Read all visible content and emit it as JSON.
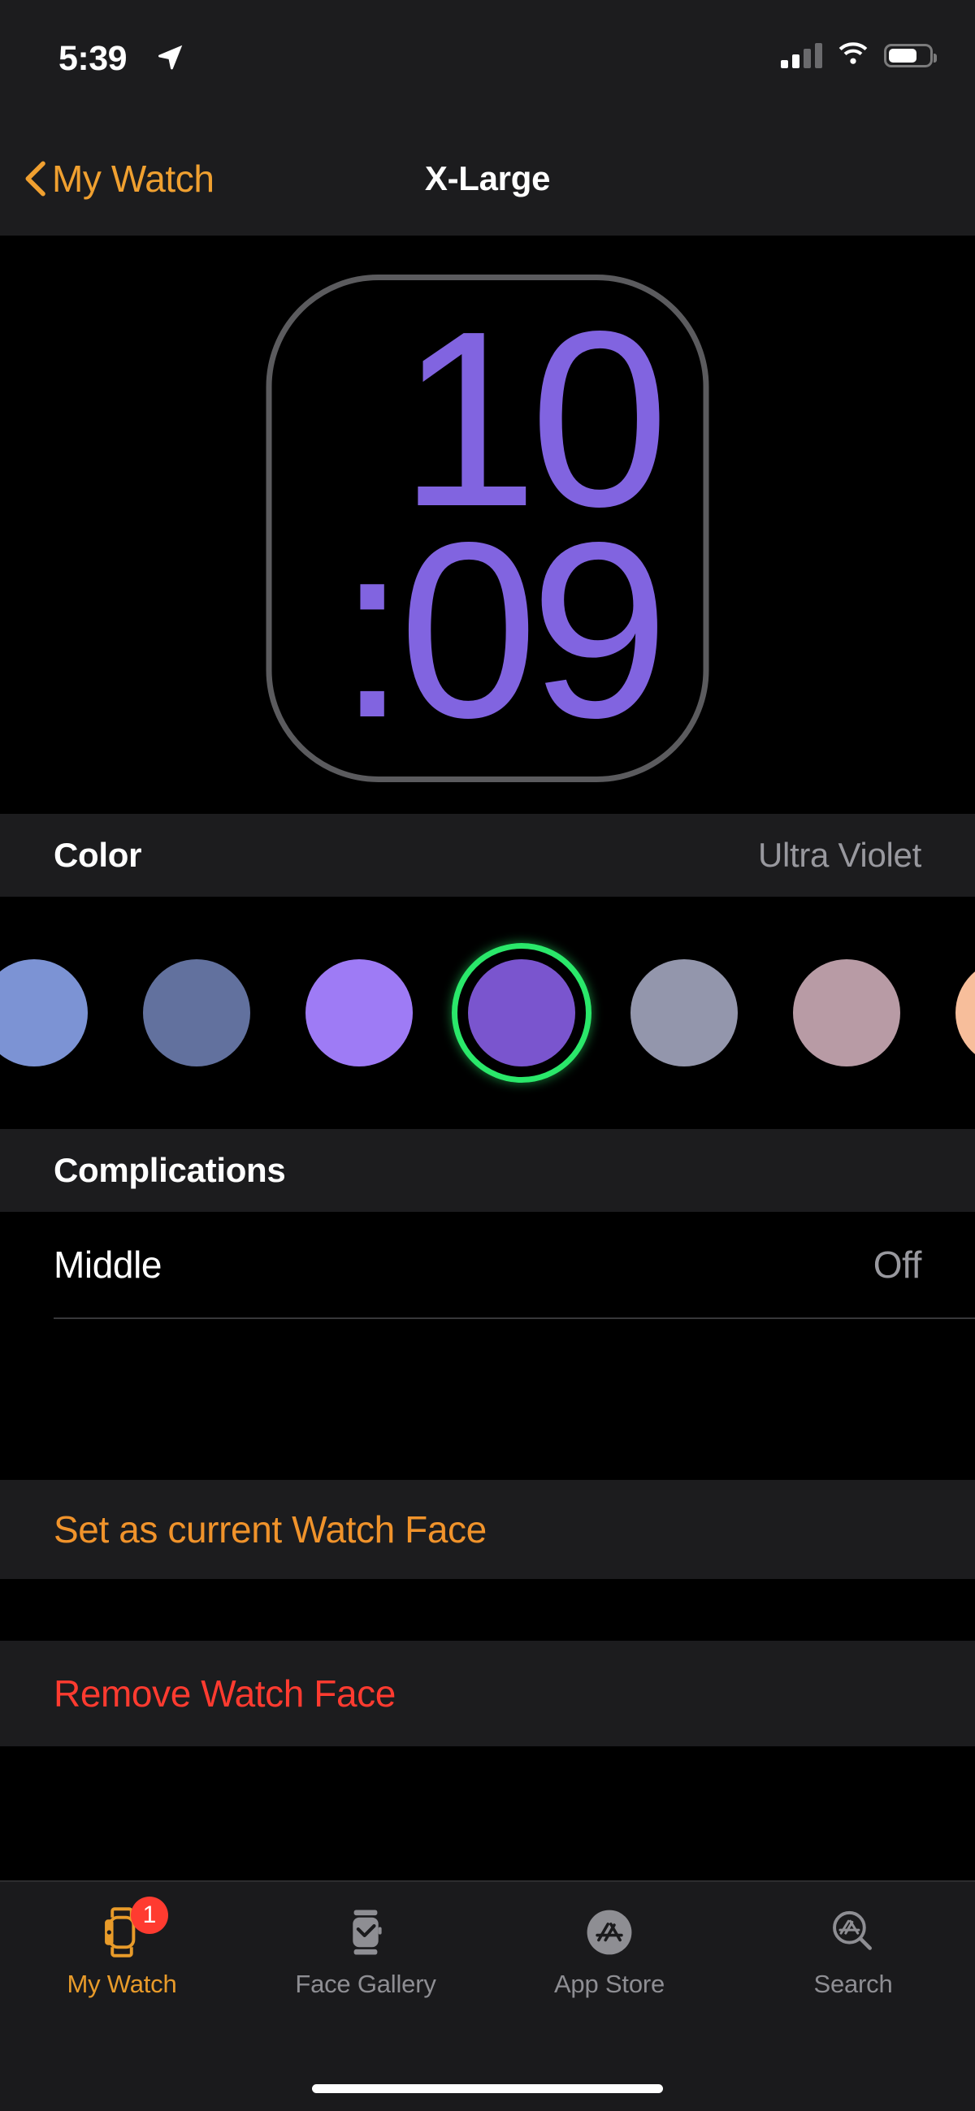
{
  "status_bar": {
    "time": "5:39",
    "location_icon": "location-arrow-icon",
    "signal_icon": "cellular-signal-icon",
    "signal_bars_filled": 2,
    "signal_bars_total": 4,
    "wifi_icon": "wifi-icon",
    "battery_icon": "battery-icon",
    "battery_level_pct": 63
  },
  "nav": {
    "back_label": "My Watch",
    "back_icon": "chevron-left-icon",
    "title": "X-Large"
  },
  "watch_face": {
    "hour": "10",
    "minute": ":09",
    "digit_color": "#8164E0",
    "bezel_color": "#5b5b5e"
  },
  "color_section": {
    "title": "Color",
    "value": "Ultra Violet",
    "selected_index": 3,
    "selection_ring_color": "#2AE86A",
    "swatches": [
      {
        "name": "cornflower",
        "hex": "#7C93D4"
      },
      {
        "name": "slate-blue",
        "hex": "#62719E"
      },
      {
        "name": "lavender",
        "hex": "#9E7BF5"
      },
      {
        "name": "ultra-violet",
        "hex": "#7A55CE"
      },
      {
        "name": "gray-blue",
        "hex": "#9396AC"
      },
      {
        "name": "dusty-mauve",
        "hex": "#B89BA5"
      },
      {
        "name": "peach",
        "hex": "#F7BE9B"
      }
    ]
  },
  "complications_section": {
    "title": "Complications",
    "rows": [
      {
        "label": "Middle",
        "value": "Off"
      }
    ]
  },
  "actions": {
    "set_current": {
      "label": "Set as current Watch Face",
      "color": "#F0932B"
    },
    "remove": {
      "label": "Remove Watch Face",
      "color": "#FF3B30"
    }
  },
  "tab_bar": {
    "active_index": 0,
    "active_color": "#E89B2A",
    "inactive_color": "#8E8E93",
    "tabs": [
      {
        "label": "My Watch",
        "icon": "watch-icon",
        "badge": "1"
      },
      {
        "label": "Face Gallery",
        "icon": "watch-face-icon",
        "badge": null
      },
      {
        "label": "App Store",
        "icon": "app-store-icon",
        "badge": null
      },
      {
        "label": "Search",
        "icon": "search-app-store-icon",
        "badge": null
      }
    ]
  }
}
